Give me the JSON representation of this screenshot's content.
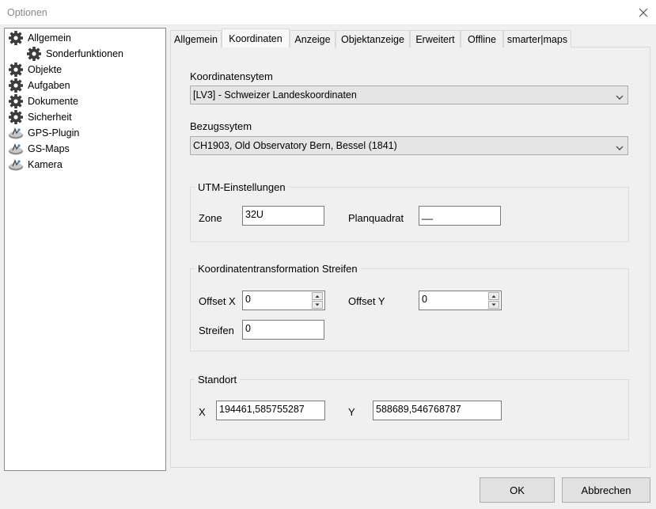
{
  "window": {
    "title": "Optionen"
  },
  "tree": {
    "items": [
      {
        "label": "Allgemein",
        "icon": "gear-icon"
      },
      {
        "label": "Sonderfunktionen",
        "icon": "gear-icon"
      },
      {
        "label": "Objekte",
        "icon": "gear-icon"
      },
      {
        "label": "Aufgaben",
        "icon": "gear-icon"
      },
      {
        "label": "Dokumente",
        "icon": "gear-icon"
      },
      {
        "label": "Sicherheit",
        "icon": "gear-icon"
      },
      {
        "label": "GPS-Plugin",
        "icon": "plugin-icon"
      },
      {
        "label": "GS-Maps",
        "icon": "plugin-icon"
      },
      {
        "label": "Kamera",
        "icon": "plugin-icon"
      }
    ]
  },
  "tabs": [
    {
      "label": "Allgemein"
    },
    {
      "label": "Koordinaten",
      "active": true
    },
    {
      "label": "Anzeige"
    },
    {
      "label": "Objektanzeige"
    },
    {
      "label": "Erweitert"
    },
    {
      "label": "Offline"
    },
    {
      "label": "smarter|maps"
    }
  ],
  "koordinaten": {
    "system_label": "Koordinatensytem",
    "system_value": "[LV3] - Schweizer Landeskoordinaten",
    "bezug_label": "Bezugssytem",
    "bezug_value": "CH1903, Old Observatory Bern, Bessel (1841)",
    "utm": {
      "title": "UTM-Einstellungen",
      "zone_label": "Zone",
      "zone_value": "32U",
      "planquadrat_label": "Planquadrat",
      "planquadrat_value": "__"
    },
    "transformation": {
      "title": "Koordinatentransformation Streifen",
      "offset_x_label": "Offset X",
      "offset_x_value": "0",
      "offset_y_label": "Offset Y",
      "offset_y_value": "0",
      "streifen_label": "Streifen",
      "streifen_value": "0"
    },
    "standort": {
      "title": "Standort",
      "x_label": "X",
      "x_value": "194461,585755287",
      "y_label": "Y",
      "y_value": "588689,546768787"
    }
  },
  "buttons": {
    "ok": "OK",
    "cancel": "Abbrechen"
  }
}
